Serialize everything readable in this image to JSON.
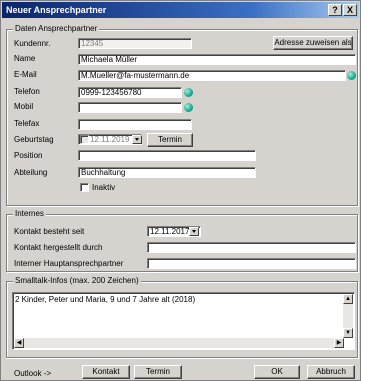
{
  "window": {
    "title": "Neuer Ansprechpartner",
    "help_btn": "?",
    "close_btn": "X"
  },
  "contact": {
    "legend": "Daten Ansprechpartner",
    "kundennr_label": "Kundennr.",
    "kundennr_value": "12345",
    "assign_button": "Adresse zuweisen als ...",
    "name_label": "Name",
    "name_value": "Michaela Müller",
    "email_label": "E-Mail",
    "email_value": "M.Mueller@fa-mustermann.de",
    "telefon_label": "Telefon",
    "telefon_value": "0999-123456780",
    "mobil_label": "Mobil",
    "mobil_value": "",
    "telefax_label": "Telefax",
    "telefax_value": "",
    "geburtstag_label": "Geburtstag",
    "geburtstag_value": "12.11.2019",
    "termin_button": "Termin",
    "position_label": "Position",
    "position_value": "",
    "abteilung_label": "Abteilung",
    "abteilung_value": "Buchhaltung",
    "inaktiv_label": "Inaktiv"
  },
  "internal": {
    "legend": "Internes",
    "kontakt_seit_label": "Kontakt besteht seit",
    "kontakt_seit_value": "12.11.2017",
    "hergestellt_label": "Kontakt hergestellt durch",
    "hergestellt_value": "",
    "haupt_label": "Interner Hauptansprechpartner",
    "haupt_value": ""
  },
  "smalltalk": {
    "legend": "Smalltalk-Infos (max. 200 Zeichen)",
    "text": "2 Kinder, Peter und Maria, 9 und 7 Jahre alt (2018)"
  },
  "footer": {
    "outlook_label": "Outlook ->",
    "kontakt_button": "Kontakt",
    "termin_button": "Termin",
    "ok_button": "OK",
    "abbruch_button": "Abbruch"
  }
}
